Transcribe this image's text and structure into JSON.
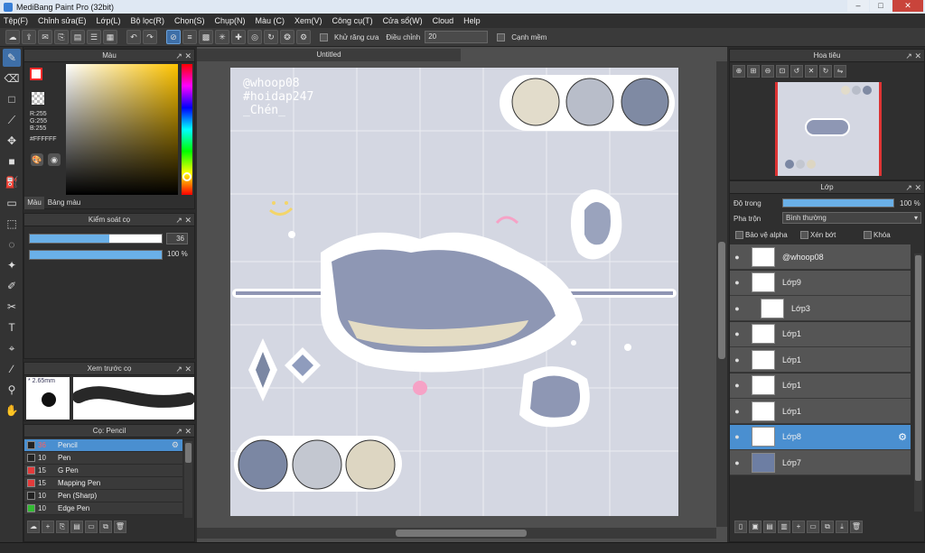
{
  "window": {
    "title": "MediBang Paint Pro (32bit)",
    "min": "–",
    "max": "□",
    "close": "✕"
  },
  "menu": [
    "Tệp(F)",
    "Chỉnh sửa(E)",
    "Lớp(L)",
    "Bộ lọc(R)",
    "Chọn(S)",
    "Chụp(N)",
    "Màu (C)",
    "Xem(V)",
    "Công cụ(T)",
    "Cửa sổ(W)",
    "Cloud",
    "Help"
  ],
  "toolbar": {
    "antialias_label": "Khử răng cưa",
    "correction_label": "Điều chỉnh",
    "correction_value": "20",
    "edge_label": "Cạnh mềm"
  },
  "color_panel": {
    "title": "Màu",
    "r": "R:255",
    "g": "G:255",
    "b": "B:255",
    "hex": "#FFFFFF",
    "tab_color": "Màu",
    "tab_palette": "Bảng màu",
    "primary": "#ff2a2a",
    "secondary": "#33cc33",
    "hue_marker": "#ffd700"
  },
  "brush_control": {
    "title": "Kiểm soát cọ",
    "size": "36",
    "opacity": "100 %",
    "size_level": 0.6,
    "opacity_level": 1.0
  },
  "brush_preview": {
    "title": "Xem trước cọ",
    "size": "2.65mm"
  },
  "brush_list": {
    "title": "Cọ: Pencil",
    "items": [
      {
        "size": "36",
        "name": "Pencil",
        "color": "#222222",
        "selected": true
      },
      {
        "size": "10",
        "name": "Pen",
        "color": "#222222",
        "selected": false
      },
      {
        "size": "15",
        "name": "G Pen",
        "color": "#e33b3b",
        "selected": false
      },
      {
        "size": "15",
        "name": "Mapping Pen",
        "color": "#e33b3b",
        "selected": false
      },
      {
        "size": "10",
        "name": "Pen (Sharp)",
        "color": "#222222",
        "selected": false
      },
      {
        "size": "10",
        "name": "Edge Pen",
        "color": "#33bb33",
        "selected": false
      }
    ]
  },
  "document": {
    "tab": "Untitled",
    "text_lines": [
      "@whoop08",
      "#hoidap247",
      "_Chén_"
    ]
  },
  "navigator": {
    "title": "Hoa tiêu"
  },
  "layers": {
    "title": "Lớp",
    "opacity_label": "Độ trong",
    "opacity_value": "100 %",
    "opacity_level": 1.0,
    "blend_label": "Pha trộn",
    "blend_value": "Bình thường",
    "protect_alpha": "Bảo vệ alpha",
    "clipping": "Xén bớt",
    "lock": "Khóa",
    "items": [
      {
        "name": "@whoop08",
        "selected": false,
        "indent": false
      },
      {
        "name": "Lớp9",
        "selected": false,
        "indent": false
      },
      {
        "name": "Lớp3",
        "selected": false,
        "indent": true
      },
      {
        "name": "Lớp1",
        "selected": false,
        "indent": false
      },
      {
        "name": "Lớp1",
        "selected": false,
        "indent": false
      },
      {
        "name": "Lớp1",
        "selected": false,
        "indent": false
      },
      {
        "name": "Lớp1",
        "selected": false,
        "indent": false
      },
      {
        "name": "Lớp8",
        "selected": true,
        "indent": false
      },
      {
        "name": "Lớp7",
        "selected": false,
        "indent": false
      }
    ]
  }
}
